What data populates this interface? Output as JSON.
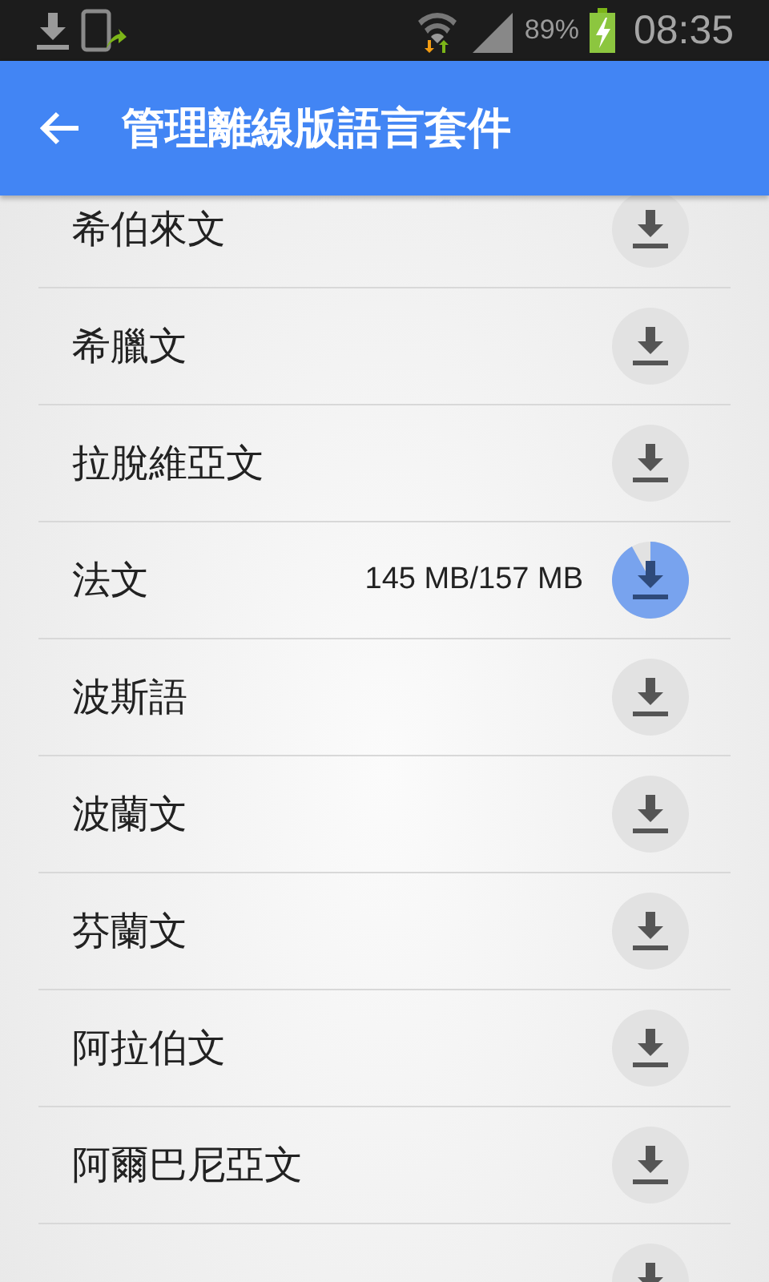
{
  "status_bar": {
    "battery": "89%",
    "time": "08:35"
  },
  "app_bar": {
    "title": "管理離線版語言套件"
  },
  "languages": [
    {
      "name": "希伯來文",
      "downloading": false
    },
    {
      "name": "希臘文",
      "downloading": false
    },
    {
      "name": "拉脫維亞文",
      "downloading": false
    },
    {
      "name": "法文",
      "downloading": true,
      "progress": "145 MB/157 MB",
      "level": 0.92
    },
    {
      "name": "波斯語",
      "downloading": false
    },
    {
      "name": "波蘭文",
      "downloading": false
    },
    {
      "name": "芬蘭文",
      "downloading": false
    },
    {
      "name": "阿拉伯文",
      "downloading": false
    },
    {
      "name": "阿爾巴尼亞文",
      "downloading": false
    },
    {
      "downloading": false
    }
  ]
}
